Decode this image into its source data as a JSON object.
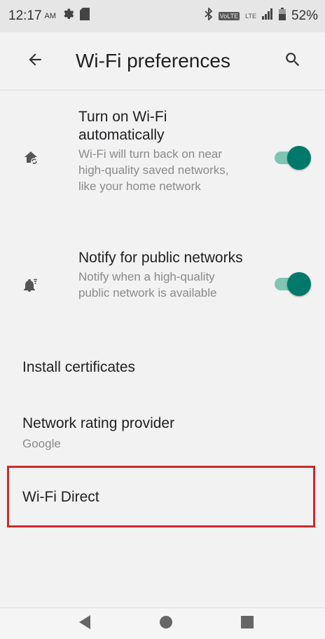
{
  "status_bar": {
    "time": "12:17",
    "ampm": "AM",
    "volte": "VoLTE",
    "lte": "LTE",
    "battery": "52%",
    "icons": [
      "settings-gear-icon",
      "sd-card-icon",
      "bluetooth-icon",
      "volte-icon",
      "signal-icon",
      "battery-icon"
    ]
  },
  "app_bar": {
    "title": "Wi-Fi preferences",
    "back_icon": "arrow-left-icon",
    "search_icon": "search-icon"
  },
  "preferences": {
    "auto_wifi": {
      "title": "Turn on Wi-Fi automatically",
      "summary": "Wi-Fi will turn back on near high-quality saved networks, like your home network",
      "icon": "home-wifi-sync-icon",
      "enabled": true
    },
    "notify_public": {
      "title": "Notify for public networks",
      "summary": "Notify when a high-quality public network is available",
      "icon": "bell-wifi-icon",
      "enabled": true
    },
    "install_certificates": {
      "title": "Install certificates"
    },
    "network_rating": {
      "title": "Network rating provider",
      "summary": "Google"
    },
    "wifi_direct": {
      "title": "Wi-Fi Direct"
    }
  },
  "colors": {
    "accent": "#00796b",
    "track": "#80c4b4",
    "highlight": "#cc2b2b",
    "background": "#f2f2f2"
  },
  "nav_bar": {
    "icons": [
      "back-triangle-icon",
      "home-circle-icon",
      "recents-square-icon"
    ]
  }
}
